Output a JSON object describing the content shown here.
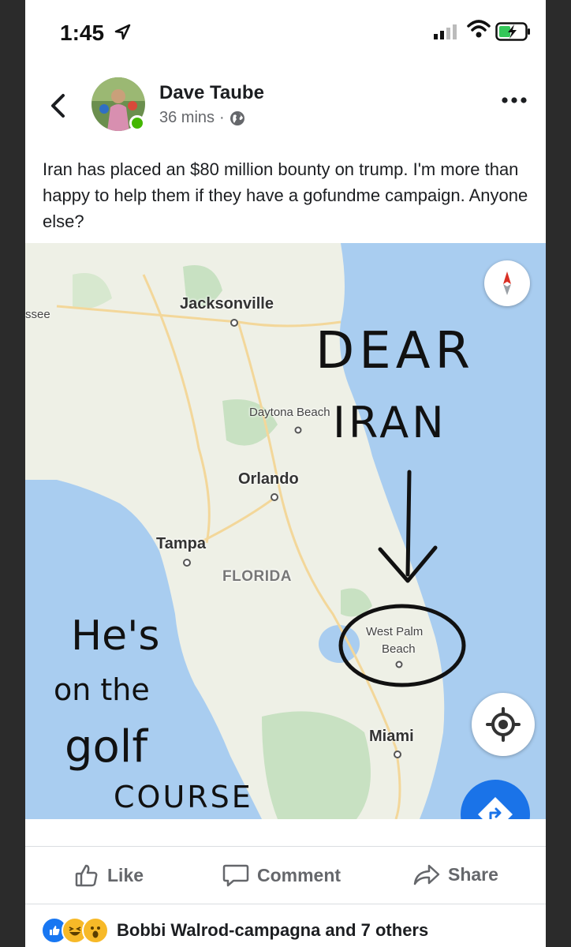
{
  "status_bar": {
    "time": "1:45"
  },
  "post": {
    "author": "Dave Taube",
    "time": "36 mins",
    "text": "Iran has placed an $80 million bounty on trump.  I'm more than happy to help them if they have a gofundme campaign.  Anyone else?"
  },
  "map": {
    "labels": {
      "left_edge": "ssee",
      "jacksonville": "Jacksonville",
      "daytona": "Daytona Beach",
      "orlando": "Orlando",
      "tampa": "Tampa",
      "florida": "FLORIDA",
      "west_palm": "West Palm",
      "west_palm_2": "Beach",
      "miami": "Miami"
    },
    "handwriting": {
      "dear": "DEAR",
      "iran": "IRAN",
      "hes": "He's",
      "on_the": "on the",
      "golf": "golf",
      "course": "COURSE"
    },
    "colors": {
      "water": "#a9cdf0",
      "land": "#eef0e6",
      "park": "#c8e1c2",
      "road": "#f3d79a"
    }
  },
  "actions": {
    "like": "Like",
    "comment": "Comment",
    "share": "Share"
  },
  "reactions": {
    "text": "Bobbi Walrod-campagna and 7 others"
  },
  "colors": {
    "accent": "#1a73e8",
    "secondary_text": "#65676b"
  }
}
